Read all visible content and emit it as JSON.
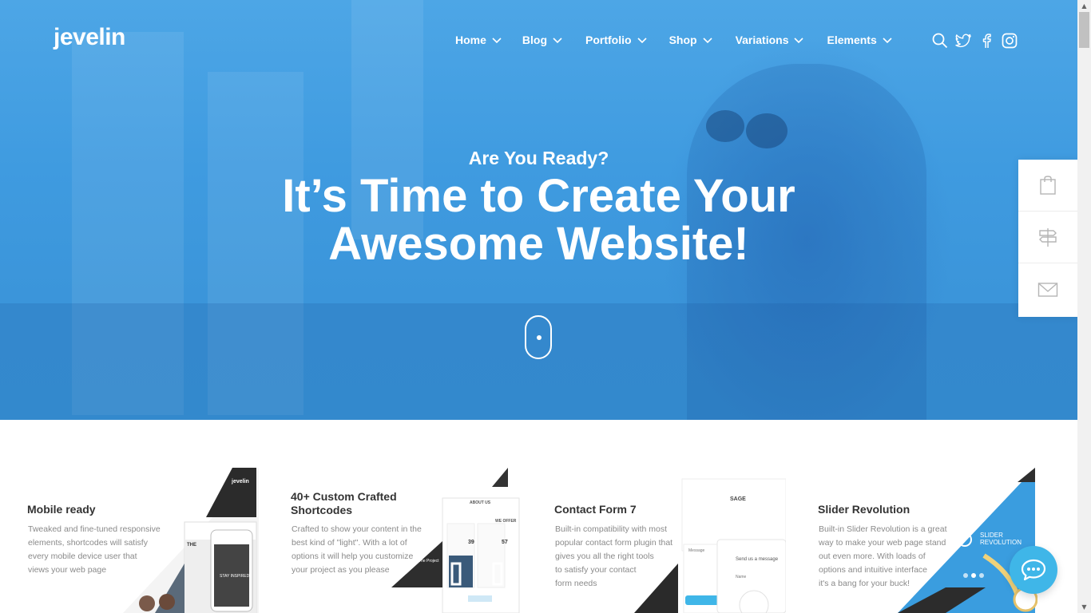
{
  "brand": {
    "logo_text": "jevelin"
  },
  "nav": {
    "items": [
      {
        "label": "Home"
      },
      {
        "label": "Blog"
      },
      {
        "label": "Portfolio"
      },
      {
        "label": "Shop"
      },
      {
        "label": "Variations"
      },
      {
        "label": "Elements"
      }
    ],
    "icons": [
      "search-icon",
      "twitter-icon",
      "facebook-icon",
      "instagram-icon"
    ]
  },
  "hero": {
    "subtitle": "Are You Ready?",
    "title_line1": "It’s Time to Create Your",
    "title_line2": "Awesome Website!",
    "accent_color": "#3f9be0"
  },
  "side_panel": {
    "icons": [
      "shopping-bag-icon",
      "signpost-icon",
      "envelope-icon"
    ]
  },
  "features": [
    {
      "title": "Mobile ready",
      "lines": [
        "Tweaked and fine-tuned responsive",
        "elements, shortcodes will satisfy",
        "every mobile device user that",
        "views your web page"
      ],
      "mock_logo": "jevelin",
      "mock_caption": "STAY INSPIRED",
      "mock_label": "THE"
    },
    {
      "title_line1": "40+ Custom Crafted",
      "title_line2": "Shortcodes",
      "lines": [
        "Crafted to show your content in the",
        "best kind of \"light\". With a lot of",
        "options it will help you customize",
        "your project as you please"
      ],
      "mock_about": "ABOUT US",
      "mock_offer": "WE OFFER",
      "mock_price1": "39",
      "mock_price2": "57",
      "mock_project": "The Project"
    },
    {
      "title": "Contact Form 7",
      "lines": [
        "Built-in compatibility with most",
        "popular contact form plugin that",
        "gives you all the right tools",
        "to satisfy your contact",
        "form needs"
      ],
      "mock_heading": "SAGE",
      "mock_send": "Send us a message",
      "mock_name": "Name",
      "mock_message": "Message"
    },
    {
      "title": "Slider Revolution",
      "lines": [
        "Built-in Slider Revolution is a great",
        "way to make your web page stand",
        "out even more. With loads of",
        "options and intuitive interface",
        "it's a bang for your buck!"
      ],
      "mock_label1": "SLIDER",
      "mock_label2": "REVOLUTION"
    }
  ]
}
